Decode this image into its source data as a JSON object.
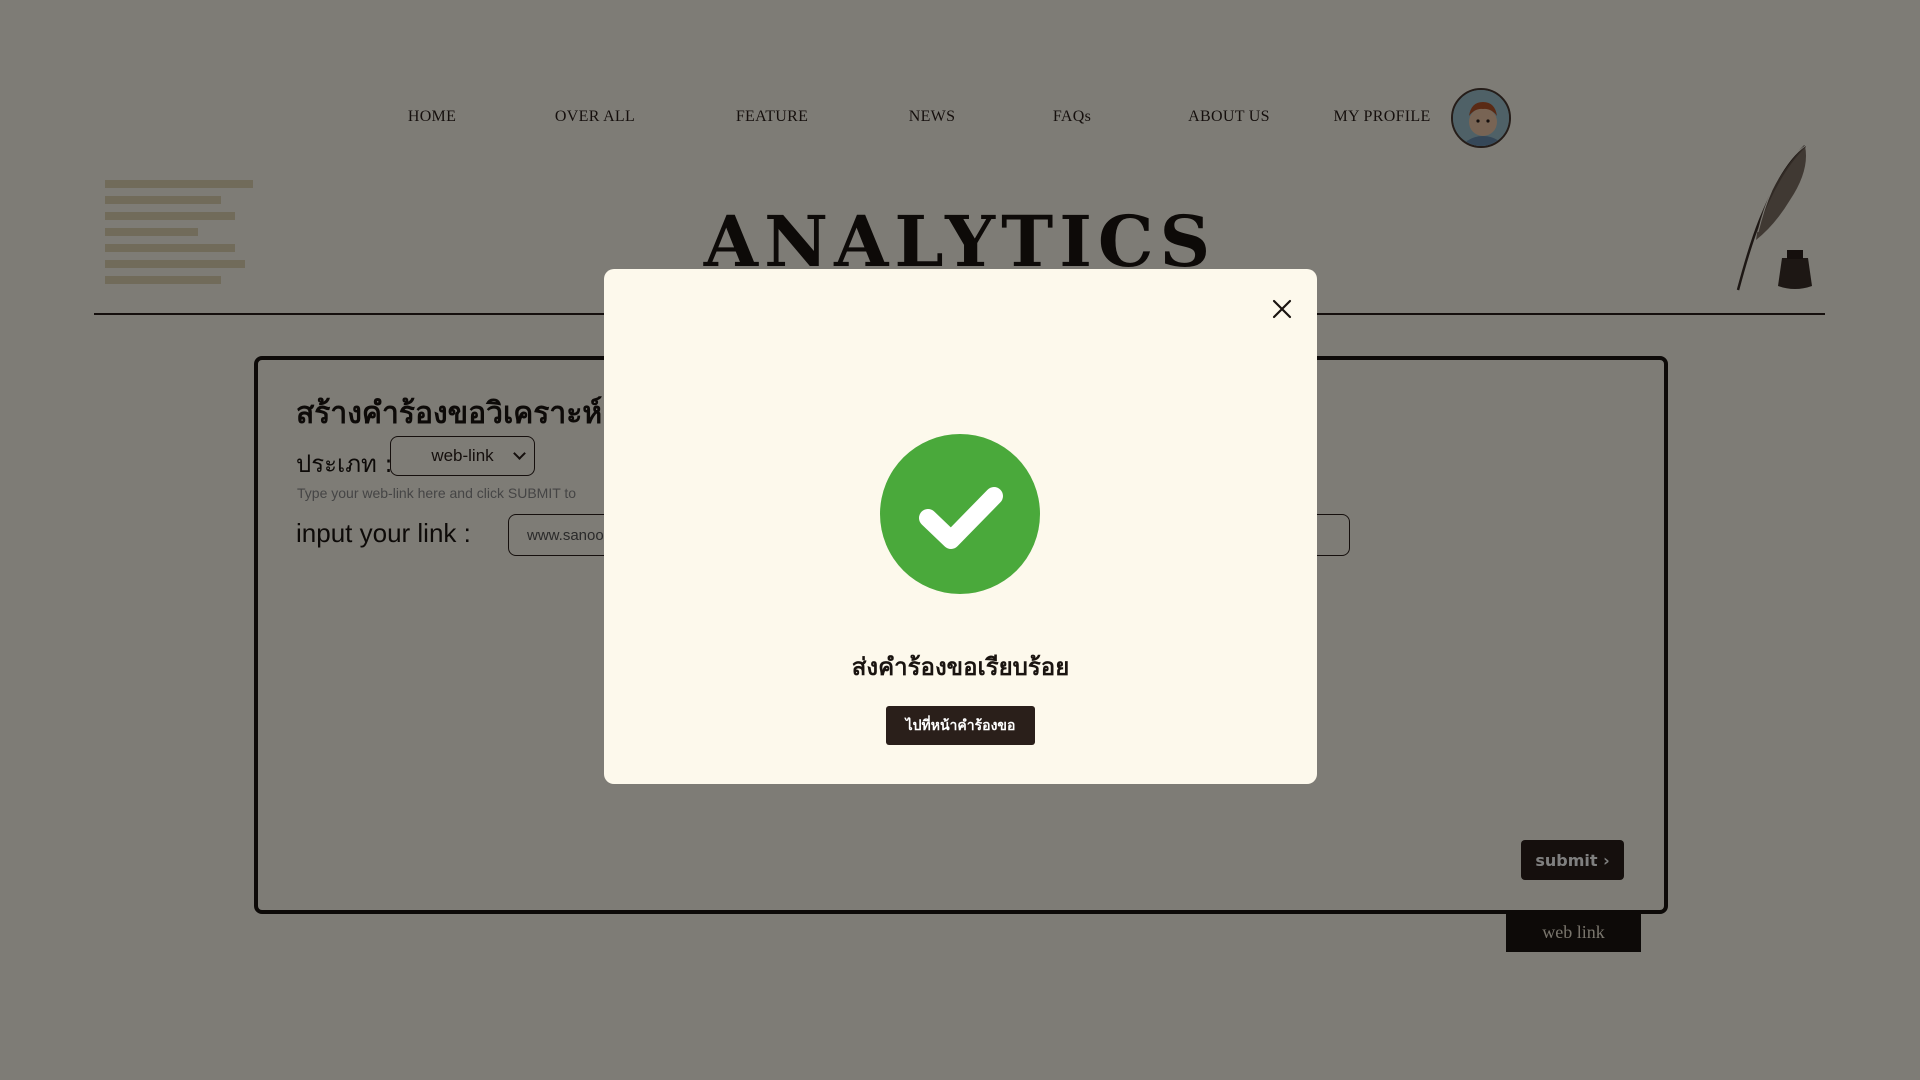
{
  "nav": {
    "items": [
      "HOME",
      "OVER ALL",
      "FEATURE",
      "NEWS",
      "FAQs",
      "ABOUT US",
      "MY PROFILE"
    ],
    "avatar_icon": "user-avatar-icon"
  },
  "header": {
    "title": "ANALYTICS",
    "menu_icon": "hamburger-lines-icon",
    "decor_icon": "quill-inkwell-icon"
  },
  "form": {
    "heading": "สร้างคำร้องขอวิเคราะห์",
    "type_label": "ประเภท :",
    "type_value": "web-link",
    "hint": "Type your web-link here and click SUBMIT to",
    "link_label": "input your link :",
    "link_value": "www.sanoo",
    "submit_label": "submit ›",
    "tab_label": "web link"
  },
  "modal": {
    "message": "ส่งคำร้องขอเรียบร้อย",
    "button_label": "ไปที่หน้าคำร้องขอ",
    "close_icon": "close-icon",
    "status_icon": "check-circle-icon"
  },
  "colors": {
    "background": "#fdf8ec",
    "dark": "#2a1f1a",
    "success": "#4aa93b",
    "overlay": "rgba(0,0,0,0.5)"
  }
}
